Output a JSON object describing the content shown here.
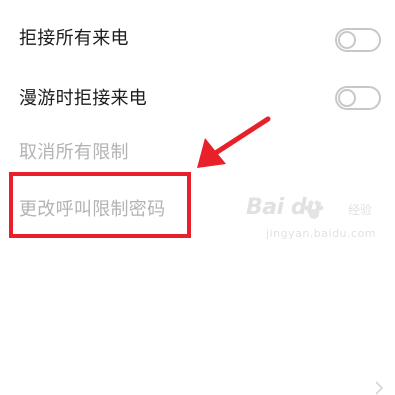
{
  "settings": {
    "items": [
      {
        "label": "拒接所有来电",
        "enabled": true,
        "toggle_on": false
      },
      {
        "label": "漫游时拒接来电",
        "enabled": true,
        "toggle_on": false
      },
      {
        "label": "取消所有限制",
        "enabled": false
      },
      {
        "label": "更改呼叫限制密码",
        "enabled": false
      }
    ]
  },
  "watermark": {
    "logo_text": "Bai du",
    "sub_text": "经验",
    "url_text": "jingyan.baidu.com"
  },
  "colors": {
    "annotation_red": "#e8202a",
    "text_primary": "#1c1c1c",
    "text_disabled": "#b3b3b3",
    "toggle_off": "#c8c8c8"
  }
}
